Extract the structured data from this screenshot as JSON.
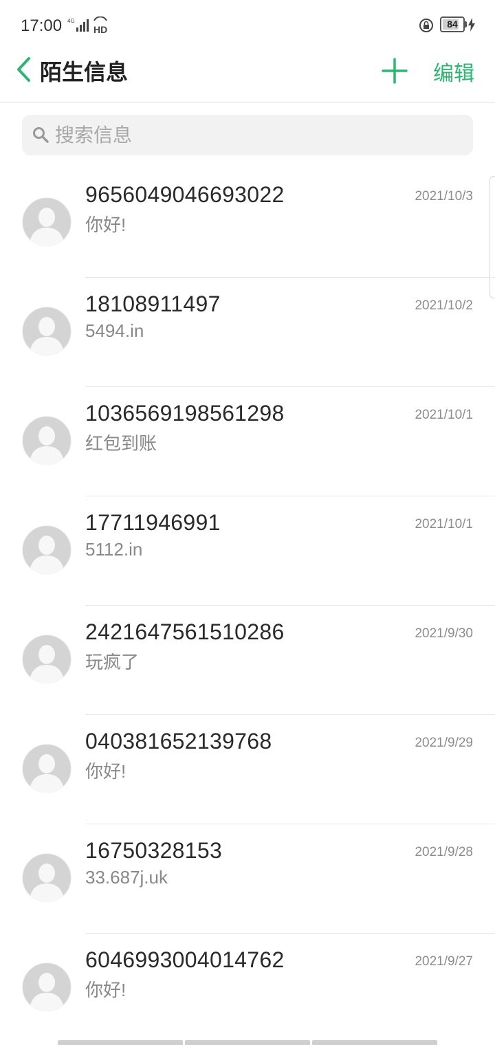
{
  "status_bar": {
    "time": "17:00",
    "battery": "84",
    "battery_level": 0.84
  },
  "header": {
    "title": "陌生信息",
    "edit_label": "编辑",
    "accent_color": "#2bb673"
  },
  "search": {
    "placeholder": "搜索信息",
    "value": ""
  },
  "messages": [
    {
      "sender": "9656049046693022",
      "preview": "你好!",
      "date": "2021/10/3"
    },
    {
      "sender": "18108911497",
      "preview": "5494.in",
      "date": "2021/10/2"
    },
    {
      "sender": "1036569198561298",
      "preview": "红包到账",
      "date": "2021/10/1"
    },
    {
      "sender": "17711946991",
      "preview": "5112.in",
      "date": "2021/10/1"
    },
    {
      "sender": "2421647561510286",
      "preview": "玩疯了",
      "date": "2021/9/30"
    },
    {
      "sender": "040381652139768",
      "preview": "你好!",
      "date": "2021/9/29"
    },
    {
      "sender": "16750328153",
      "preview": "33.687j.uk",
      "date": "2021/9/28"
    },
    {
      "sender": "6046993004014762",
      "preview": "你好!",
      "date": "2021/9/27"
    }
  ],
  "icons": [
    "signal-4g-icon",
    "hd-icon",
    "lock-rotation-icon",
    "battery-icon",
    "charging-icon",
    "back-icon",
    "add-icon",
    "search-icon",
    "avatar-icon"
  ]
}
